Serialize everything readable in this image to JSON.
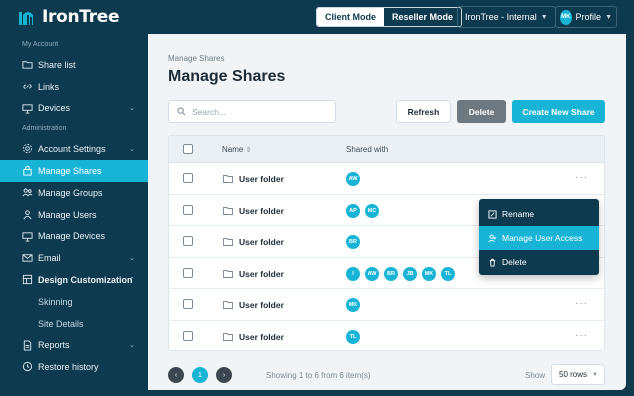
{
  "brand": {
    "name": "IronTree"
  },
  "topbar": {
    "modes": [
      "Client Mode",
      "Reseller Mode"
    ],
    "active_mode": "Client Mode",
    "tenant": "IronTree - Internal",
    "profile_initials": "MK",
    "profile_label": "Profile"
  },
  "sidebar": {
    "sections": [
      {
        "label": "My Account",
        "items": [
          {
            "label": "Share list",
            "icon": "folder-icon"
          },
          {
            "label": "Links",
            "icon": "link-icon"
          },
          {
            "label": "Devices",
            "icon": "monitor-icon",
            "chevron": true
          }
        ]
      },
      {
        "label": "Administration",
        "items": [
          {
            "label": "Account Settings",
            "icon": "gear-icon",
            "chevron": true
          },
          {
            "label": "Manage Shares",
            "icon": "lock-icon",
            "active": true
          },
          {
            "label": "Manage Groups",
            "icon": "users-icon"
          },
          {
            "label": "Manage Users",
            "icon": "user-icon"
          },
          {
            "label": "Manage Devices",
            "icon": "monitor-icon"
          },
          {
            "label": "Email",
            "icon": "mail-icon",
            "chevron": true
          },
          {
            "label": "Design Customization",
            "icon": "palette-icon",
            "chevron_up": true
          },
          {
            "label": "Skinning",
            "sub": true
          },
          {
            "label": "Site Details",
            "sub": true
          },
          {
            "label": "Reports",
            "icon": "file-icon",
            "chevron": true
          },
          {
            "label": "Restore history",
            "icon": "history-icon"
          }
        ]
      }
    ]
  },
  "main": {
    "breadcrumb": "Manage Shares",
    "title": "Manage Shares",
    "search_placeholder": "Search...",
    "refresh_label": "Refresh",
    "delete_label": "Delete",
    "create_label": "Create New Share",
    "table": {
      "col_name": "Name",
      "col_shared": "Shared with",
      "sort_indicator": "⇕",
      "rows": [
        {
          "name": "User folder",
          "shared": [
            "AW"
          ]
        },
        {
          "name": "User folder",
          "shared": [
            "AP",
            "MC"
          ]
        },
        {
          "name": "User folder",
          "shared": [
            "BR"
          ]
        },
        {
          "name": "User folder",
          "shared": [
            "I",
            "AW",
            "BR",
            "JB",
            "MK",
            "TL"
          ]
        },
        {
          "name": "User folder",
          "shared": [
            "MK"
          ]
        },
        {
          "name": "User folder",
          "shared": [
            "TL"
          ]
        }
      ],
      "more_label": "···"
    },
    "context_menu": {
      "items": [
        {
          "label": "Rename",
          "icon": "edit-icon"
        },
        {
          "label": "Manage User Access",
          "icon": "user-access-icon",
          "active": true
        },
        {
          "label": "Delete",
          "icon": "trash-icon"
        }
      ]
    },
    "pagination": {
      "prev": "‹",
      "current": "1",
      "next": "›",
      "showing": "Showing 1 to 6 from 6 item(s)",
      "show_label": "Show",
      "rows_per_page": "50 rows"
    }
  },
  "colors": {
    "accent": "#18b4d6",
    "navy": "#0e3a50",
    "delete_gray": "#6e7880"
  }
}
